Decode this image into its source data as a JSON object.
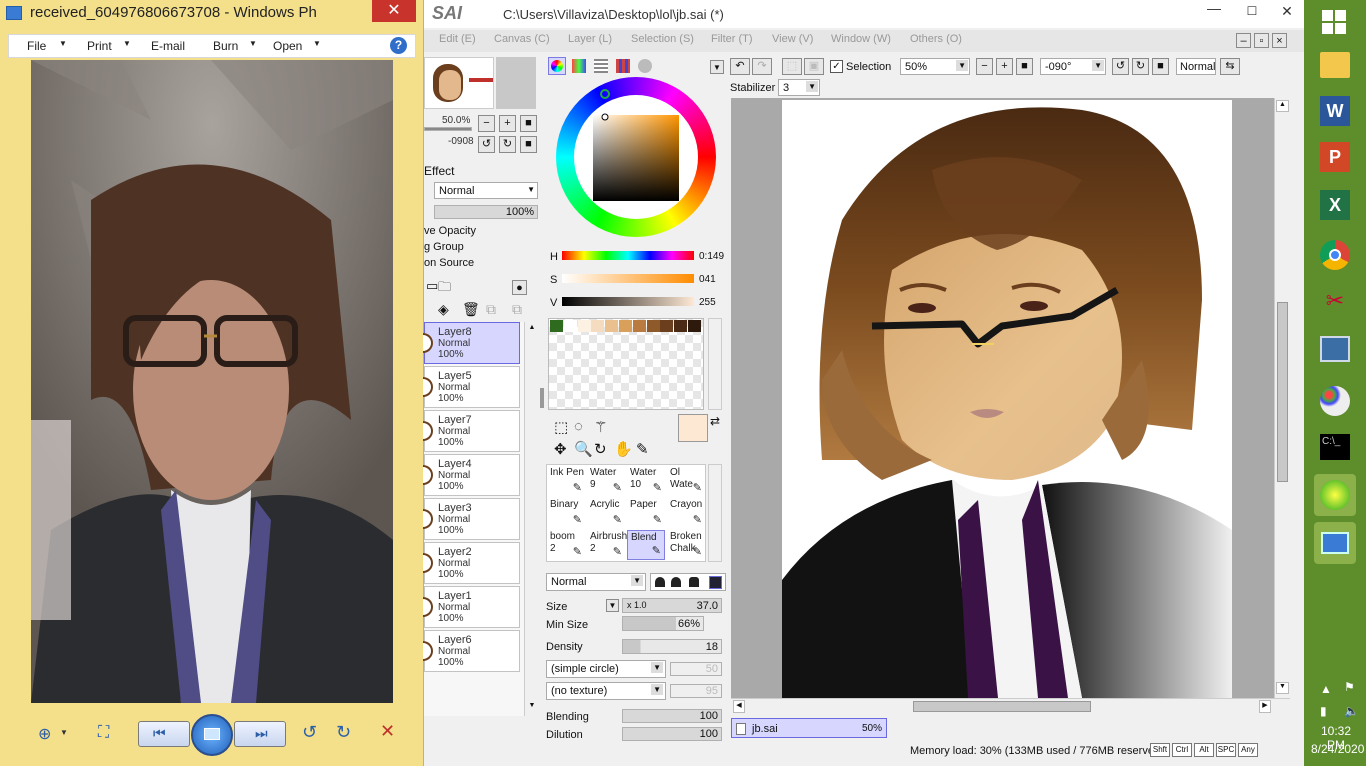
{
  "photo_viewer": {
    "title": "received_604976806673708 - Windows Ph",
    "close_glyph": "✕",
    "menu": [
      {
        "label": "File"
      },
      {
        "label": "Print"
      },
      {
        "label": "E-mail"
      },
      {
        "label": "Burn"
      },
      {
        "label": "Open"
      }
    ],
    "help_glyph": "?"
  },
  "sai": {
    "brand": "SAI",
    "title": "C:\\Users\\Villaviza\\Desktop\\lol\\jb.sai (*)",
    "menu": [
      "Edit (E)",
      "Canvas (C)",
      "Layer (L)",
      "Selection (S)",
      "Filter (T)",
      "View (V)",
      "Window (W)",
      "Others (O)"
    ],
    "toolbar": {
      "selection_label": "Selection",
      "zoom": "50%",
      "rotation": "-090°",
      "mode": "Normal",
      "stabilizer_label": "Stabilizer",
      "stabilizer_value": "3"
    },
    "navigator": {
      "zoom": "50.0%",
      "angle": "-0908"
    },
    "layer_panel": {
      "effect_label": "Effect",
      "blend_mode": "Normal",
      "opacity": "100%",
      "preserve_opacity": "ve Opacity",
      "clipping_group": "g Group",
      "selection_source": "on Source",
      "layers": [
        {
          "name": "Layer8",
          "mode": "Normal",
          "opacity": "100%",
          "selected": true
        },
        {
          "name": "Layer5",
          "mode": "Normal",
          "opacity": "100%"
        },
        {
          "name": "Layer7",
          "mode": "Normal",
          "opacity": "100%"
        },
        {
          "name": "Layer4",
          "mode": "Normal",
          "opacity": "100%"
        },
        {
          "name": "Layer3",
          "mode": "Normal",
          "opacity": "100%"
        },
        {
          "name": "Layer2",
          "mode": "Normal",
          "opacity": "100%"
        },
        {
          "name": "Layer1",
          "mode": "Normal",
          "opacity": "100%"
        },
        {
          "name": "Layer6",
          "mode": "Normal",
          "opacity": "100%"
        }
      ]
    },
    "color": {
      "h_label": "H",
      "h_value": "0:149",
      "s_label": "S",
      "s_value": "041",
      "v_label": "V",
      "v_value": "255",
      "primary": "#fde8d4",
      "swatches": [
        "#2e6b1e",
        "#ffffff",
        "#fdf1e4",
        "#f5dcc0",
        "#e9c08e",
        "#d9a05c",
        "#b97b3f",
        "#8e5a2a",
        "#6b3f1d",
        "#4a2a14",
        "#2e1a0c"
      ]
    },
    "tools": [
      {
        "name": "Ink Pen",
        "size": ""
      },
      {
        "name": "Water",
        "size": "9"
      },
      {
        "name": "Water",
        "size": "10"
      },
      {
        "name": "Ol Wate",
        "size": ""
      },
      {
        "name": "Binary",
        "size": ""
      },
      {
        "name": "Acrylic",
        "size": ""
      },
      {
        "name": "Paper",
        "size": ""
      },
      {
        "name": "Crayon",
        "size": ""
      },
      {
        "name": "boom",
        "size": "2"
      },
      {
        "name": "Airbrush",
        "size": "2"
      },
      {
        "name": "Blend",
        "size": "",
        "selected": true
      },
      {
        "name": "Broken",
        "size": "Chalk"
      }
    ],
    "brush": {
      "mode": "Normal",
      "size_label": "Size",
      "size_mult": "x 1.0",
      "size_value": "37.0",
      "min_size_label": "Min Size",
      "min_size_value": "66%",
      "density_label": "Density",
      "density_value": "18",
      "shape": "(simple circle)",
      "shape_value": "50",
      "texture": "(no texture)",
      "texture_value": "95",
      "blending_label": "Blending",
      "blending_value": "100",
      "dilution_label": "Dilution",
      "dilution_value": "100"
    },
    "doc_tab": {
      "name": "jb.sai",
      "zoom": "50%"
    },
    "status": {
      "memory": "Memory load: 30% (133MB used / 776MB reserved)",
      "keys": [
        "Shft",
        "Ctrl",
        "Alt",
        "SPC",
        "Any"
      ]
    }
  },
  "taskbar": {
    "time": "10:32 PM",
    "date": "8/24/2020"
  }
}
